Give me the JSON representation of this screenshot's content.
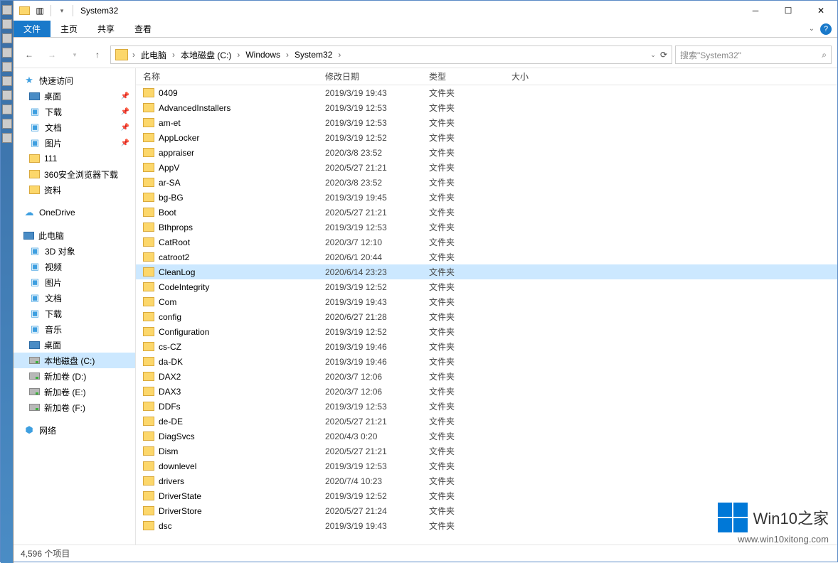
{
  "title": "System32",
  "ribbon": {
    "file": "文件",
    "tabs": [
      "主页",
      "共享",
      "查看"
    ]
  },
  "breadcrumb": [
    "此电脑",
    "本地磁盘 (C:)",
    "Windows",
    "System32"
  ],
  "search_placeholder": "搜索\"System32\"",
  "columns": {
    "name": "名称",
    "date": "修改日期",
    "type": "类型",
    "size": "大小"
  },
  "nav": {
    "quick": {
      "label": "快速访问",
      "items": [
        {
          "label": "桌面",
          "pin": true,
          "icon": "monitor"
        },
        {
          "label": "下载",
          "pin": true,
          "icon": "blue"
        },
        {
          "label": "文档",
          "pin": true,
          "icon": "blue"
        },
        {
          "label": "图片",
          "pin": true,
          "icon": "blue"
        },
        {
          "label": "111",
          "icon": "folder"
        },
        {
          "label": "360安全浏览器下载",
          "icon": "folder"
        },
        {
          "label": "资料",
          "icon": "folder"
        }
      ]
    },
    "onedrive": {
      "label": "OneDrive"
    },
    "thispc": {
      "label": "此电脑",
      "items": [
        {
          "label": "3D 对象",
          "icon": "blue"
        },
        {
          "label": "视频",
          "icon": "blue"
        },
        {
          "label": "图片",
          "icon": "blue"
        },
        {
          "label": "文档",
          "icon": "blue"
        },
        {
          "label": "下载",
          "icon": "blue"
        },
        {
          "label": "音乐",
          "icon": "blue"
        },
        {
          "label": "桌面",
          "icon": "monitor"
        },
        {
          "label": "本地磁盘 (C:)",
          "icon": "drive",
          "selected": true
        },
        {
          "label": "新加卷 (D:)",
          "icon": "drive"
        },
        {
          "label": "新加卷 (E:)",
          "icon": "drive"
        },
        {
          "label": "新加卷 (F:)",
          "icon": "drive"
        }
      ]
    },
    "network": {
      "label": "网络"
    }
  },
  "type_folder": "文件夹",
  "files": [
    {
      "name": "0409",
      "date": "2019/3/19 19:43"
    },
    {
      "name": "AdvancedInstallers",
      "date": "2019/3/19 12:53"
    },
    {
      "name": "am-et",
      "date": "2019/3/19 12:53"
    },
    {
      "name": "AppLocker",
      "date": "2019/3/19 12:52"
    },
    {
      "name": "appraiser",
      "date": "2020/3/8 23:52"
    },
    {
      "name": "AppV",
      "date": "2020/5/27 21:21"
    },
    {
      "name": "ar-SA",
      "date": "2020/3/8 23:52"
    },
    {
      "name": "bg-BG",
      "date": "2019/3/19 19:45"
    },
    {
      "name": "Boot",
      "date": "2020/5/27 21:21"
    },
    {
      "name": "Bthprops",
      "date": "2019/3/19 12:53"
    },
    {
      "name": "CatRoot",
      "date": "2020/3/7 12:10"
    },
    {
      "name": "catroot2",
      "date": "2020/6/1 20:44"
    },
    {
      "name": "CleanLog",
      "date": "2020/6/14 23:23",
      "selected": true
    },
    {
      "name": "CodeIntegrity",
      "date": "2019/3/19 12:52"
    },
    {
      "name": "Com",
      "date": "2019/3/19 19:43"
    },
    {
      "name": "config",
      "date": "2020/6/27 21:28"
    },
    {
      "name": "Configuration",
      "date": "2019/3/19 12:52"
    },
    {
      "name": "cs-CZ",
      "date": "2019/3/19 19:46"
    },
    {
      "name": "da-DK",
      "date": "2019/3/19 19:46"
    },
    {
      "name": "DAX2",
      "date": "2020/3/7 12:06"
    },
    {
      "name": "DAX3",
      "date": "2020/3/7 12:06"
    },
    {
      "name": "DDFs",
      "date": "2019/3/19 12:53"
    },
    {
      "name": "de-DE",
      "date": "2020/5/27 21:21"
    },
    {
      "name": "DiagSvcs",
      "date": "2020/4/3 0:20"
    },
    {
      "name": "Dism",
      "date": "2020/5/27 21:21"
    },
    {
      "name": "downlevel",
      "date": "2019/3/19 12:53"
    },
    {
      "name": "drivers",
      "date": "2020/7/4 10:23"
    },
    {
      "name": "DriverState",
      "date": "2019/3/19 12:52"
    },
    {
      "name": "DriverStore",
      "date": "2020/5/27 21:24"
    },
    {
      "name": "dsc",
      "date": "2019/3/19 19:43"
    }
  ],
  "status": "4,596 个项目",
  "watermark": {
    "brand_a": "Win10",
    "brand_b": "之家",
    "url": "www.win10xitong.com"
  }
}
